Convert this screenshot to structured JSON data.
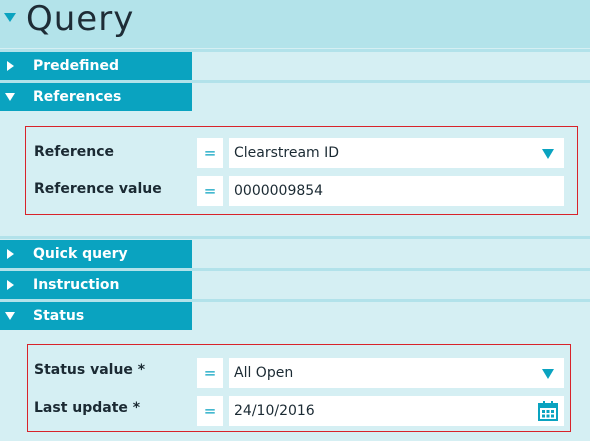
{
  "header": {
    "title": "Query"
  },
  "sections": {
    "predefined": {
      "label": "Predefined",
      "expanded": false
    },
    "references": {
      "label": "References",
      "expanded": true
    },
    "quick_query": {
      "label": "Quick query",
      "expanded": false
    },
    "instruction": {
      "label": "Instruction",
      "expanded": false
    },
    "status": {
      "label": "Status",
      "expanded": true
    }
  },
  "references_panel": {
    "reference": {
      "label": "Reference",
      "operator": "=",
      "value": "Clearstream ID"
    },
    "reference_value": {
      "label": "Reference value",
      "operator": "=",
      "value": "0000009854"
    }
  },
  "status_panel": {
    "status_value": {
      "label": "Status value *",
      "operator": "=",
      "value": "All Open"
    },
    "last_update": {
      "label": "Last update *",
      "operator": "=",
      "value": "24/10/2016"
    }
  },
  "colors": {
    "accent": "#0aa3c0",
    "background": "#d5eff3",
    "header_bg": "#b3e3ea",
    "highlight_border": "#d8232a"
  }
}
